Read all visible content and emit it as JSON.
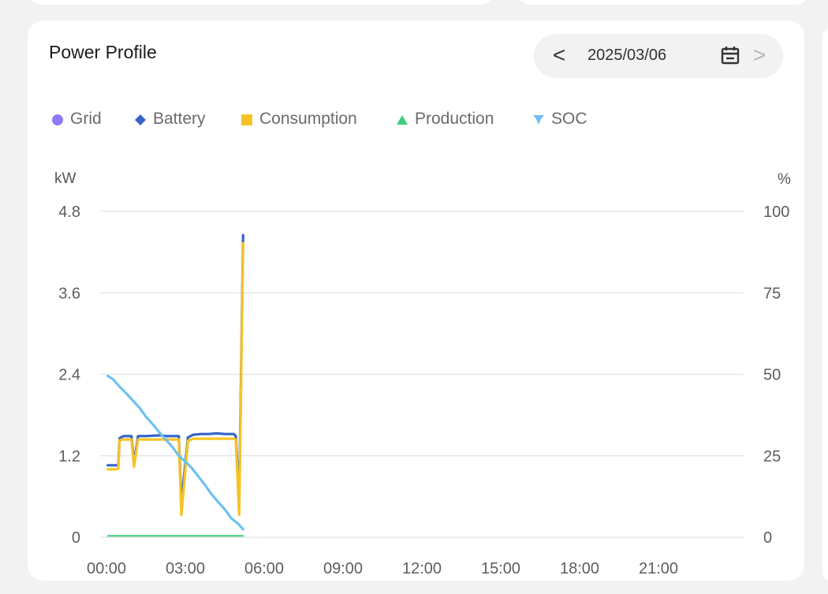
{
  "card": {
    "title": "Power Profile"
  },
  "date_nav": {
    "prev_symbol": "<",
    "date": "2025/03/06",
    "next_symbol": ">",
    "calendar_icon": "calendar-icon"
  },
  "colors": {
    "grid": "#8b7cf6",
    "battery": "#3565c9",
    "consumption": "#f7c324",
    "production": "#3ecf7a",
    "soc": "#6ec1f2",
    "gridline": "#e6e6e6"
  },
  "chart_data": {
    "type": "line",
    "legend": [
      {
        "name": "Grid",
        "marker": "circle",
        "color": "#8b7cf6"
      },
      {
        "name": "Battery",
        "marker": "diamond",
        "color": "#3565c9"
      },
      {
        "name": "Consumption",
        "marker": "square",
        "color": "#f7c324"
      },
      {
        "name": "Production",
        "marker": "triangle",
        "color": "#3ecf7a"
      },
      {
        "name": "SOC",
        "marker": "pin",
        "color": "#6ec1f2"
      }
    ],
    "legend_position": "top-left",
    "y_left": {
      "unit": "kW",
      "range": [
        0,
        4.8
      ],
      "ticks": [
        "0",
        "1.2",
        "2.4",
        "3.6",
        "4.8"
      ]
    },
    "y_right": {
      "unit": "%",
      "range": [
        0,
        100
      ],
      "ticks": [
        "0",
        "25",
        "50",
        "75",
        "100"
      ]
    },
    "x_axis": {
      "range_hours": [
        0,
        24
      ],
      "ticks": [
        "00:00",
        "03:00",
        "06:00",
        "09:00",
        "12:00",
        "15:00",
        "18:00",
        "21:00"
      ]
    },
    "grid": true,
    "series": [
      {
        "name": "Battery",
        "axis": "left",
        "color": "#3565c9",
        "points": [
          [
            0.05,
            1.06
          ],
          [
            0.35,
            1.06
          ],
          [
            0.45,
            1.06
          ],
          [
            0.5,
            1.46
          ],
          [
            0.65,
            1.49
          ],
          [
            0.95,
            1.49
          ],
          [
            1.05,
            1.09
          ],
          [
            1.2,
            1.49
          ],
          [
            1.5,
            1.49
          ],
          [
            2.0,
            1.5
          ],
          [
            2.3,
            1.49
          ],
          [
            2.75,
            1.49
          ],
          [
            2.85,
            0.5
          ],
          [
            3.1,
            1.47
          ],
          [
            3.3,
            1.51
          ],
          [
            3.6,
            1.52
          ],
          [
            3.9,
            1.52
          ],
          [
            4.2,
            1.53
          ],
          [
            4.5,
            1.52
          ],
          [
            4.85,
            1.52
          ],
          [
            4.92,
            1.49
          ],
          [
            5.05,
            0.55
          ],
          [
            5.2,
            4.45
          ]
        ]
      },
      {
        "name": "Consumption",
        "axis": "left",
        "color": "#f7c324",
        "points": [
          [
            0.05,
            1.0
          ],
          [
            0.35,
            1.0
          ],
          [
            0.45,
            1.01
          ],
          [
            0.5,
            1.43
          ],
          [
            0.65,
            1.44
          ],
          [
            0.95,
            1.44
          ],
          [
            1.05,
            1.04
          ],
          [
            1.2,
            1.44
          ],
          [
            1.5,
            1.44
          ],
          [
            2.0,
            1.44
          ],
          [
            2.3,
            1.44
          ],
          [
            2.75,
            1.44
          ],
          [
            2.85,
            0.33
          ],
          [
            3.1,
            1.42
          ],
          [
            3.3,
            1.45
          ],
          [
            3.6,
            1.45
          ],
          [
            3.9,
            1.45
          ],
          [
            4.2,
            1.45
          ],
          [
            4.5,
            1.45
          ],
          [
            4.85,
            1.45
          ],
          [
            4.92,
            1.44
          ],
          [
            5.05,
            0.33
          ],
          [
            5.2,
            4.33
          ]
        ]
      },
      {
        "name": "Production",
        "axis": "left",
        "color": "#3ecf7a",
        "points": [
          [
            0.05,
            0.02
          ],
          [
            5.2,
            0.02
          ]
        ]
      },
      {
        "name": "SOC",
        "axis": "right",
        "color": "#6ec1f2",
        "points": [
          [
            0.05,
            49.5
          ],
          [
            0.25,
            48.5
          ],
          [
            0.5,
            46.2
          ],
          [
            0.75,
            44.2
          ],
          [
            1.0,
            42.0
          ],
          [
            1.25,
            39.8
          ],
          [
            1.5,
            37.0
          ],
          [
            1.75,
            34.8
          ],
          [
            2.0,
            32.3
          ],
          [
            2.25,
            30.0
          ],
          [
            2.5,
            27.8
          ],
          [
            2.75,
            25.0
          ],
          [
            3.0,
            23.2
          ],
          [
            3.25,
            21.2
          ],
          [
            3.5,
            18.6
          ],
          [
            3.75,
            16.0
          ],
          [
            4.0,
            13.2
          ],
          [
            4.25,
            10.8
          ],
          [
            4.5,
            8.6
          ],
          [
            4.75,
            5.8
          ],
          [
            5.0,
            4.2
          ],
          [
            5.2,
            2.4
          ]
        ]
      }
    ]
  }
}
